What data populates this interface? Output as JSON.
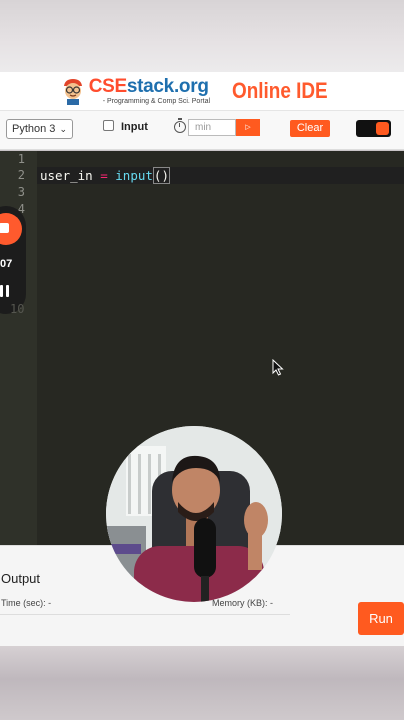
{
  "header": {
    "brand_cse": "CSE",
    "brand_rest": "stack.org",
    "tagline": "- Programming & Comp Sci. Portal",
    "ide_title": "Online IDE"
  },
  "toolbar": {
    "language_selected": "Python 3",
    "input_label": "Input",
    "timer_placeholder": "min",
    "timer_button_label": "▷",
    "clear_label": "Clear",
    "input_checked": false
  },
  "editor": {
    "line_numbers": [
      "1",
      "2",
      "3",
      "4"
    ],
    "code_var": "user_in",
    "code_op": "=",
    "code_fn": "input",
    "code_parens": "()"
  },
  "recorder": {
    "time": "07",
    "ghost_line": "10"
  },
  "output": {
    "title": "Output",
    "time_label": "Time (sec): -",
    "memory_label": "Memory (KB): -",
    "run_label": "Run"
  },
  "colors": {
    "accent": "#ff5a1f",
    "editor_bg": "#272822",
    "brand_blue": "#1e6fae"
  }
}
